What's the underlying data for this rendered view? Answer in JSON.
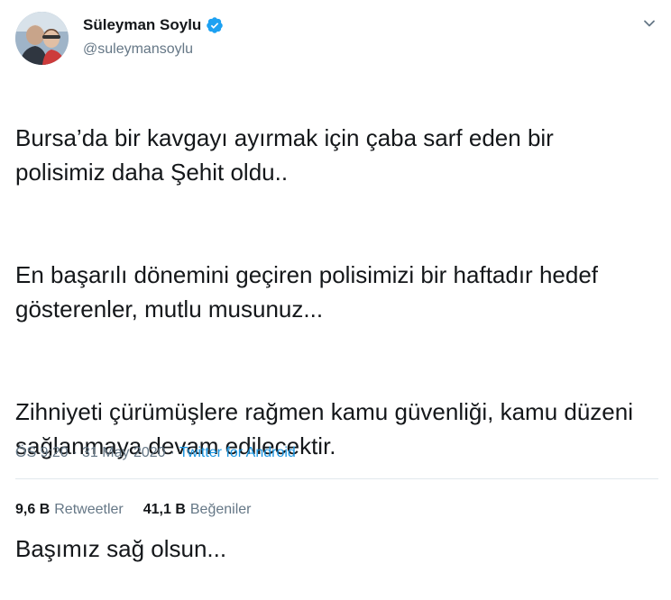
{
  "user": {
    "display_name": "Süleyman Soylu",
    "handle": "@suleymansoylu",
    "verified_icon": "verified-badge-icon",
    "verified_color": "#1da1f2"
  },
  "tweet": {
    "paragraphs": [
      "Bursa’da bir kavgayı ayırmak için çaba sarf eden bir polisimiz daha Şehit oldu..",
      "En başarılı dönemini geçiren polisimizi bir haftadır hedef gösterenler, mutlu musunuz...",
      "Zihniyeti çürümüşlere rağmen kamu güvenliği, kamu düzeni sağlanmaya devam edilecektir.",
      "Başımız sağ olsun..."
    ]
  },
  "meta": {
    "time": "ÖS 9:20",
    "separator": "·",
    "date": "31 May 2020",
    "source": "Twitter for Android"
  },
  "stats": {
    "retweets_count": "9,6 B",
    "retweets_label": "Retweetler",
    "likes_count": "41,1 B",
    "likes_label": "Beğeniler"
  },
  "colors": {
    "text": "#14171a",
    "secondary": "#657786",
    "link": "#1b95e0",
    "divider": "#e1e8ed"
  }
}
